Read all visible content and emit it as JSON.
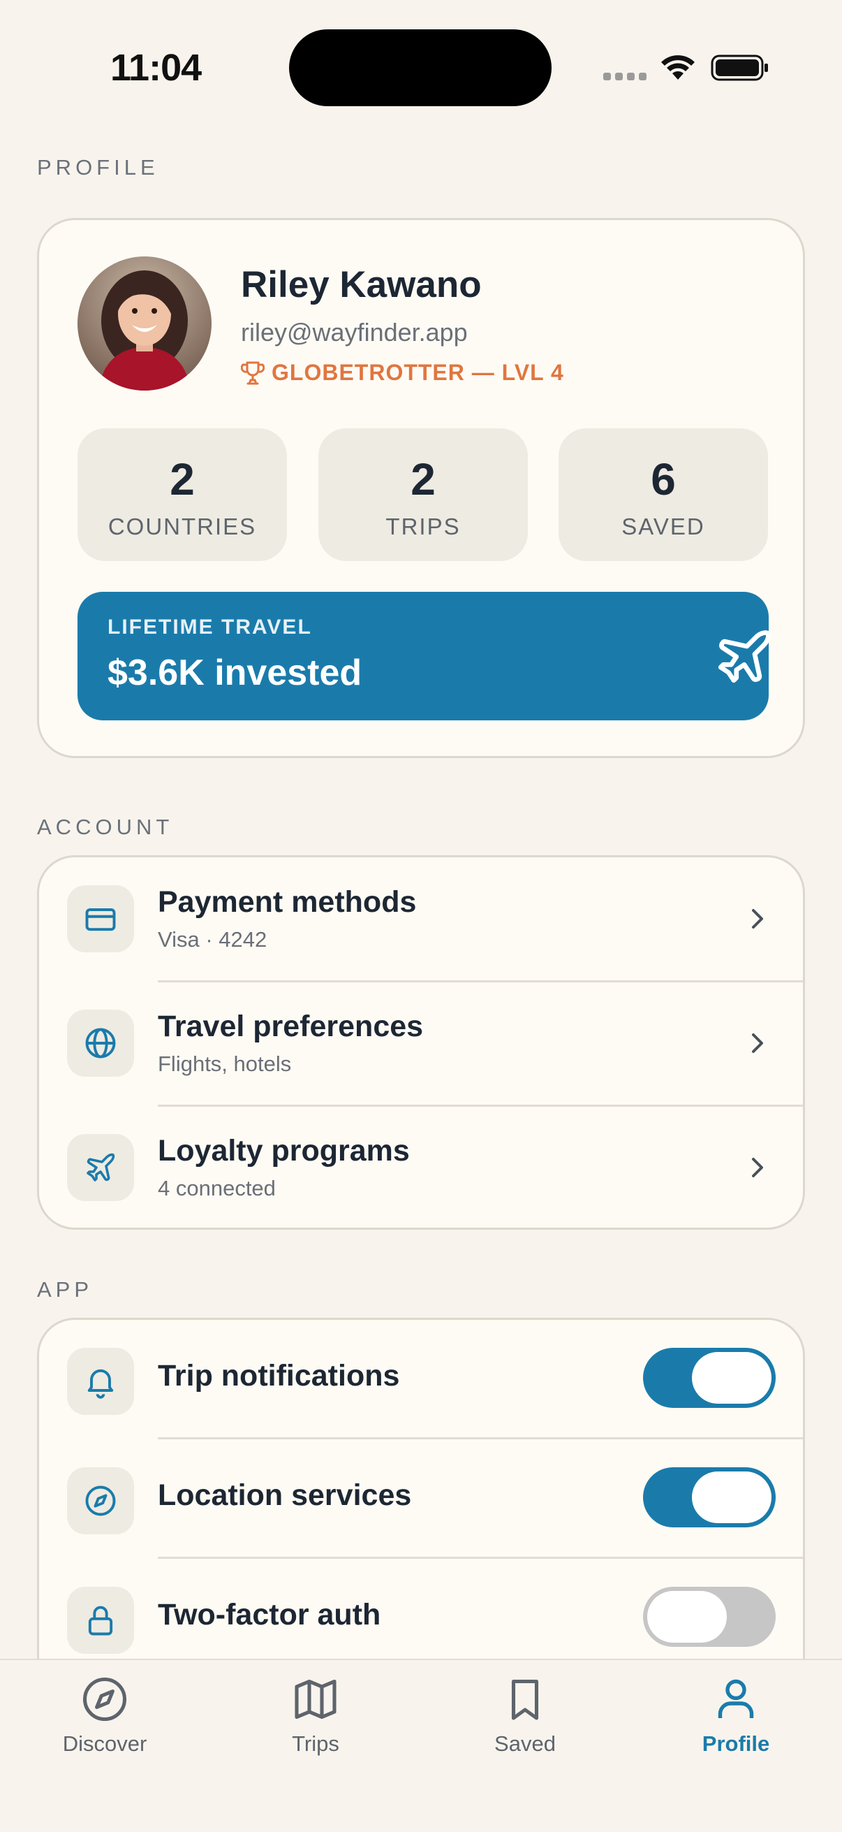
{
  "status": {
    "time": "11:04"
  },
  "profile": {
    "section_label": "PROFILE",
    "name": "Riley Kawano",
    "email": "riley@wayfinder.app",
    "rank": "GLOBETROTTER — LVL 4",
    "stats": [
      {
        "value": "2",
        "label": "COUNTRIES"
      },
      {
        "value": "2",
        "label": "TRIPS"
      },
      {
        "value": "6",
        "label": "SAVED"
      }
    ],
    "lifetime_label": "LIFETIME TRAVEL",
    "lifetime_value": "$3.6K invested"
  },
  "account": {
    "section_label": "ACCOUNT",
    "items": [
      {
        "title": "Payment methods",
        "subtitle": "Visa · 4242",
        "icon": "credit-card-icon"
      },
      {
        "title": "Travel preferences",
        "subtitle": "Flights, hotels",
        "icon": "globe-icon"
      },
      {
        "title": "Loyalty programs",
        "subtitle": "4 connected",
        "icon": "plane-icon"
      }
    ]
  },
  "app": {
    "section_label": "APP",
    "items": [
      {
        "title": "Trip notifications",
        "enabled": true,
        "icon": "bell-icon"
      },
      {
        "title": "Location services",
        "enabled": true,
        "icon": "compass-icon"
      },
      {
        "title": "Two-factor auth",
        "enabled": false,
        "icon": "lock-icon"
      }
    ]
  },
  "tabs": [
    {
      "label": "Discover",
      "icon": "compass-icon",
      "active": false
    },
    {
      "label": "Trips",
      "icon": "map-icon",
      "active": false
    },
    {
      "label": "Saved",
      "icon": "bookmark-icon",
      "active": false
    },
    {
      "label": "Profile",
      "icon": "person-icon",
      "active": true
    }
  ],
  "colors": {
    "accent": "#1a7bab",
    "rank": "#e0763f",
    "background": "#f8f4ed",
    "card": "#fefbf5"
  }
}
